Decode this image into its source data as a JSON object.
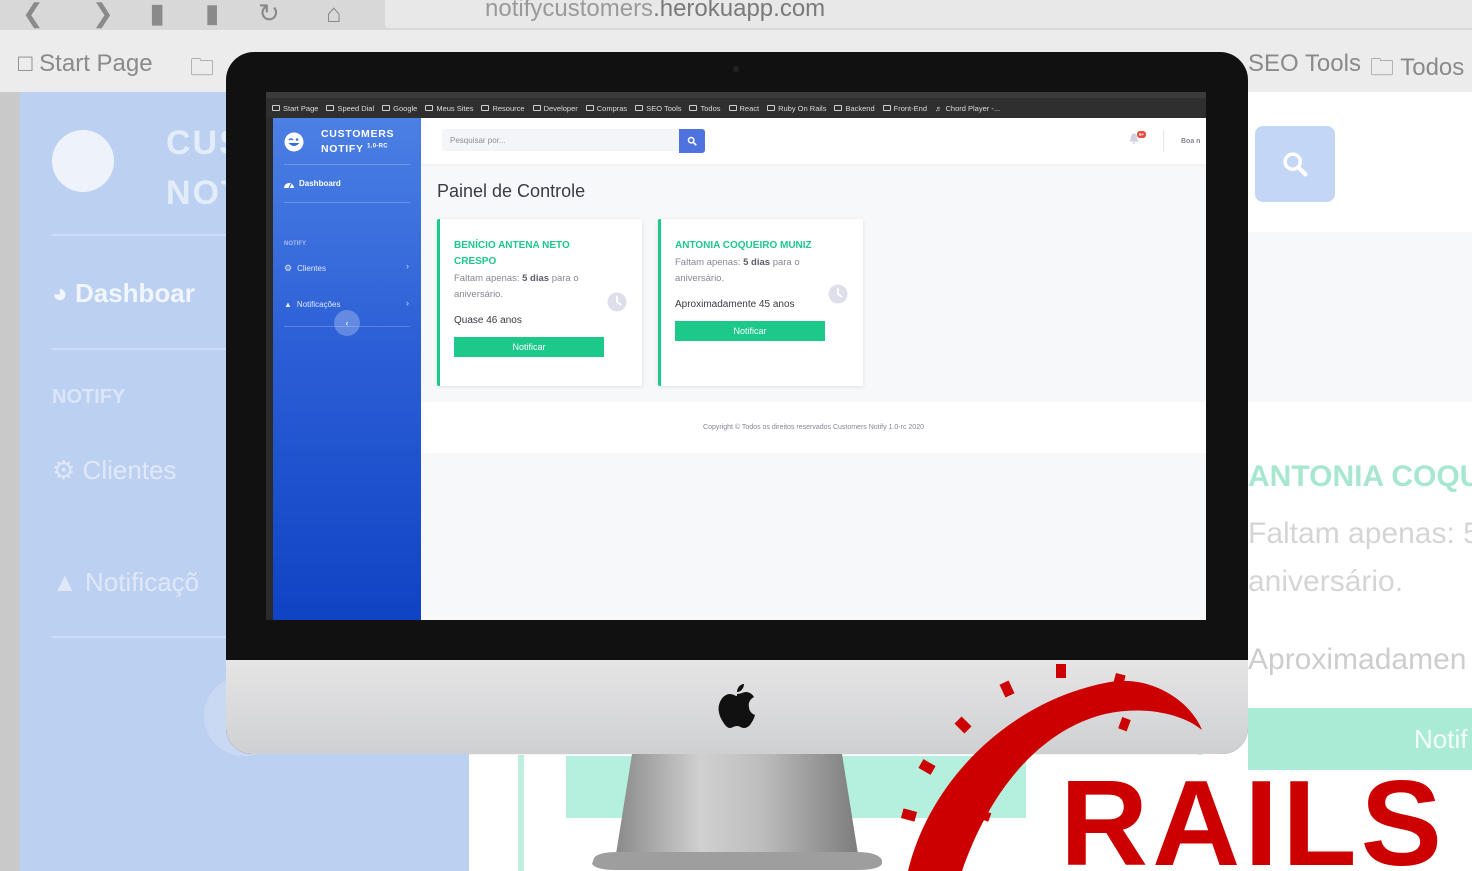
{
  "background": {
    "url_prefix": "notifycustomers",
    "url_domain": ".herokuapp.com",
    "bookmarks": {
      "start": "Start Page",
      "seo": "SEO Tools",
      "todos": "Todos"
    },
    "brand_top": "CUS",
    "brand_bottom": "NOT",
    "dashboard": "Dashboar",
    "notify": "NOTIFY",
    "clientes": "Clientes",
    "notificacoes": "Notificaçõ",
    "card_name": "ANTONIA COQU",
    "card_line1": "Faltam apenas: 5",
    "card_line2": "aniversário.",
    "card_age": "Aproximadamen",
    "card_button": "Notif"
  },
  "screen": {
    "bookmarks": [
      "Start Page",
      "Speed Dial",
      "Google",
      "Meus Sites",
      "Resource",
      "Developer",
      "Compras",
      "SEO Tools",
      "Todos",
      "React",
      "Ruby On Rails",
      "Backend",
      "Front-End",
      "Chord Player -..."
    ],
    "brand": {
      "line1": "CUSTOMERS",
      "line2": "NOTIFY",
      "version": "1.0-RC"
    },
    "sidebar": {
      "dashboard": "Dashboard",
      "heading": "NOTIFY",
      "items": [
        {
          "label": "Clientes"
        },
        {
          "label": "Notificações"
        }
      ],
      "toggle": "‹"
    },
    "topbar": {
      "search_placeholder": "Pesquisar por...",
      "badge": "9+",
      "user": "Boa n"
    },
    "page_title": "Painel de Controle",
    "cards": [
      {
        "name": "BENÍCIO ANTENA NETO CRESPO",
        "prefix": "Faltam apenas: ",
        "days": "5 dias",
        "suffix": " para o aniversário.",
        "age": "Quase 46 anos",
        "button": "Notificar"
      },
      {
        "name": "ANTONIA COQUEIRO MUNIZ",
        "prefix": "Faltam apenas: ",
        "days": "5 dias",
        "suffix": " para o aniversário.",
        "age": "Aproximadamente 45 anos",
        "button": "Notificar"
      }
    ],
    "footer": "Copyright © Todos os direitos reservados Customers Notify 1.0-rc 2020"
  },
  "colors": {
    "sidebar_top": "#4c80e4",
    "sidebar_bottom": "#0f43c4",
    "accent_green": "#1cc88a",
    "search_button": "#4e73df",
    "rails_red": "#cc0000"
  },
  "icons": [
    "back-arrow-icon",
    "forward-arrow-icon",
    "reload-icon",
    "home-icon",
    "shield-icon",
    "lock-icon",
    "page-icon",
    "folder-icon",
    "wink-logo-icon",
    "dashboard-gauge-icon",
    "gear-icon",
    "bell-icon",
    "chevron-right-icon",
    "search-icon",
    "clock-icon",
    "apple-logo-icon"
  ],
  "overlay": {
    "rails_text": "RAILS"
  }
}
